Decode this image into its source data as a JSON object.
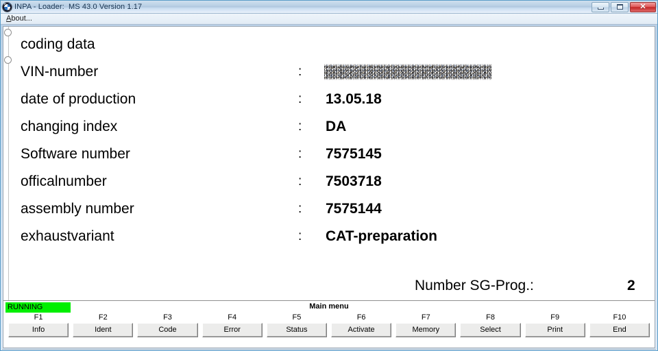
{
  "window": {
    "title": "INPA - Loader:  MS 43.0 Version 1.17",
    "icon": "bmw-roundel-icon",
    "controls": {
      "minimize_label": "–",
      "maximize_label": "□",
      "close_label": "✕"
    }
  },
  "menubar": {
    "items": [
      {
        "label": "About...",
        "accesskey": "A"
      }
    ]
  },
  "content": {
    "heading": "coding data",
    "separator": ":",
    "rows": [
      {
        "label": "VIN-number",
        "value": "",
        "redacted": true
      },
      {
        "label": "date of production",
        "value": "13.05.18",
        "redacted": false
      },
      {
        "label": "changing index",
        "value": "DA",
        "redacted": false
      },
      {
        "label": "Software number",
        "value": "7575145",
        "redacted": false
      },
      {
        "label": "officalnumber",
        "value": "7503718",
        "redacted": false
      },
      {
        "label": "assembly number",
        "value": "7575144",
        "redacted": false
      },
      {
        "label": "exhaustvariant",
        "value": "CAT-preparation",
        "redacted": false
      }
    ],
    "summary": {
      "label": "Number SG-Prog.:",
      "value": "2"
    }
  },
  "statusbar": {
    "running_label": "RUNNING",
    "running_color": "#00ef00",
    "menu_title": "Main menu"
  },
  "function_keys": [
    {
      "key": "F1",
      "label": "Info"
    },
    {
      "key": "F2",
      "label": "Ident"
    },
    {
      "key": "F3",
      "label": "Code"
    },
    {
      "key": "F4",
      "label": "Error"
    },
    {
      "key": "F5",
      "label": "Status"
    },
    {
      "key": "F6",
      "label": "Activate"
    },
    {
      "key": "F7",
      "label": "Memory"
    },
    {
      "key": "F8",
      "label": "Select"
    },
    {
      "key": "F9",
      "label": "Print"
    },
    {
      "key": "F10",
      "label": "End"
    }
  ]
}
